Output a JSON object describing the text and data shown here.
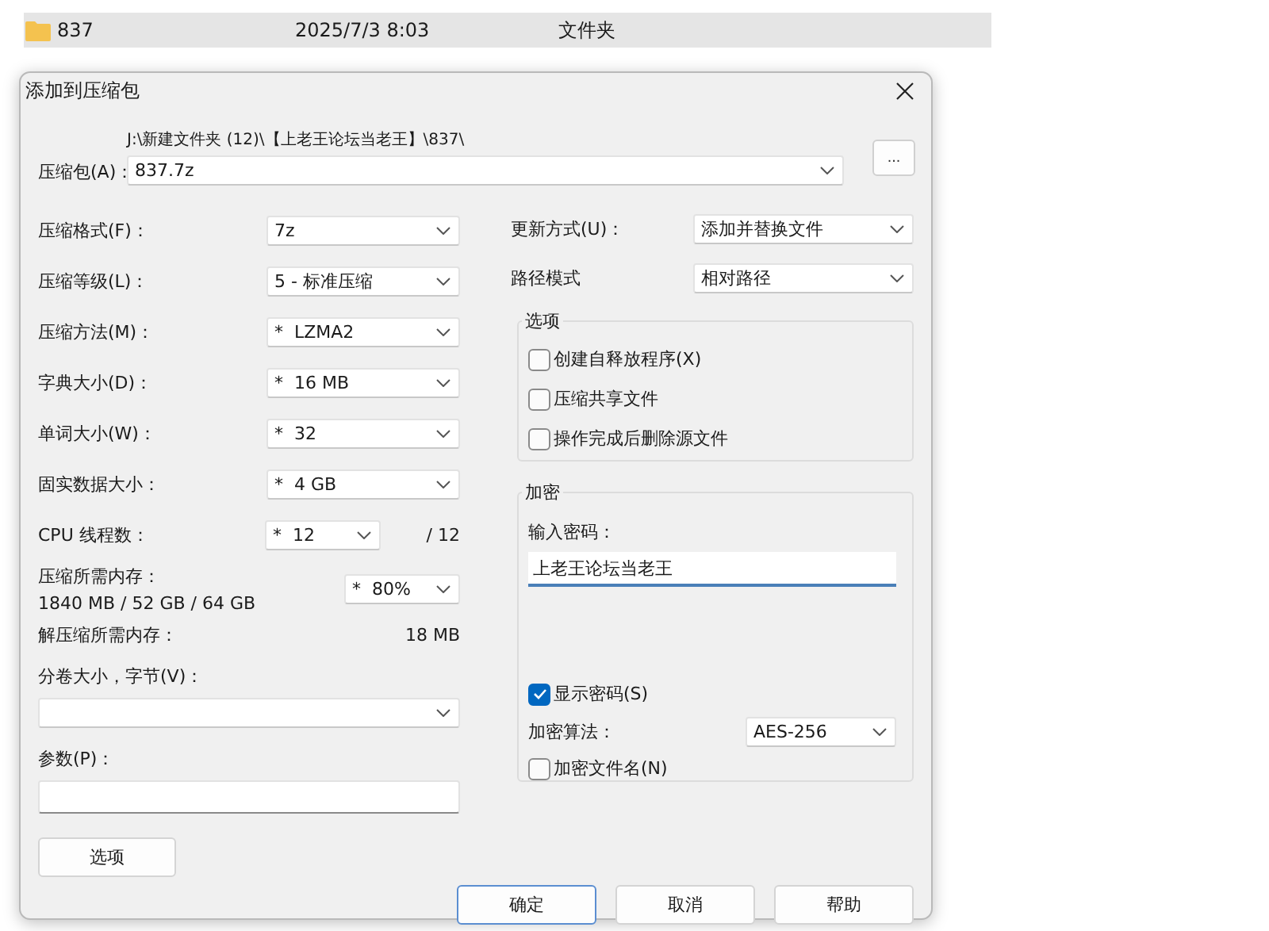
{
  "file_rows": [
    {
      "kind": "folder",
      "name": "837",
      "modified": "2025/7/3 8:03",
      "type": "文件夹",
      "selected": true
    }
  ],
  "dialog": {
    "title": "添加到压缩包",
    "archive": {
      "label": "压缩包(A)：",
      "path": "J:\\新建文件夹 (12)\\【上老王论坛当老王】\\837\\",
      "value": "837.7z",
      "browse": "..."
    },
    "left_fields": [
      {
        "kind": "select",
        "label": "压缩格式(F)：",
        "value": "7z"
      },
      {
        "kind": "select",
        "label": "压缩等级(L)：",
        "value": "5 - 标准压缩"
      },
      {
        "kind": "select",
        "label": "压缩方法(M)：",
        "value": "*  LZMA2"
      },
      {
        "kind": "select",
        "label": "字典大小(D)：",
        "value": "*  16 MB"
      },
      {
        "kind": "select",
        "label": "单词大小(W)：",
        "value": "*  32"
      },
      {
        "kind": "select",
        "label": "固实数据大小：",
        "value": "*  4 GB"
      },
      {
        "kind": "short_select",
        "label": "CPU 线程数：",
        "value": "*  12",
        "suffix": "/ 12"
      },
      {
        "kind": "memory",
        "label": "压缩所需内存：",
        "detail": "1840 MB / 52 GB / 64 GB",
        "value": "*  80%"
      },
      {
        "kind": "info",
        "label": "解压缩所需内存：",
        "value": "18 MB"
      },
      {
        "kind": "stacked_select",
        "label": "分卷大小，字节(V)："
      },
      {
        "kind": "stacked_input",
        "label": "参数(P)："
      }
    ],
    "right_fields": [
      {
        "label": "更新方式(U)：",
        "value": "添加并替换文件"
      },
      {
        "label": "路径模式",
        "value": "相对路径"
      }
    ],
    "options_group": {
      "title": "选项",
      "checkboxes": [
        {
          "label": "创建自释放程序(X)",
          "checked": false
        },
        {
          "label": "压缩共享文件",
          "checked": false
        },
        {
          "label": "操作完成后删除源文件",
          "checked": false
        }
      ]
    },
    "encryption": {
      "title": "加密",
      "password_label": "输入密码：",
      "password": "上老王论坛当老王",
      "show_password": {
        "label": "显示密码(S)",
        "checked": true
      },
      "method_label": "加密算法：",
      "method": "AES-256",
      "encrypt_names": {
        "label": "加密文件名(N)",
        "checked": false
      }
    },
    "options_button": "选项",
    "buttons": [
      {
        "label": "确定",
        "default": true
      },
      {
        "label": "取消",
        "default": false
      },
      {
        "label": "帮助",
        "default": false
      }
    ]
  }
}
